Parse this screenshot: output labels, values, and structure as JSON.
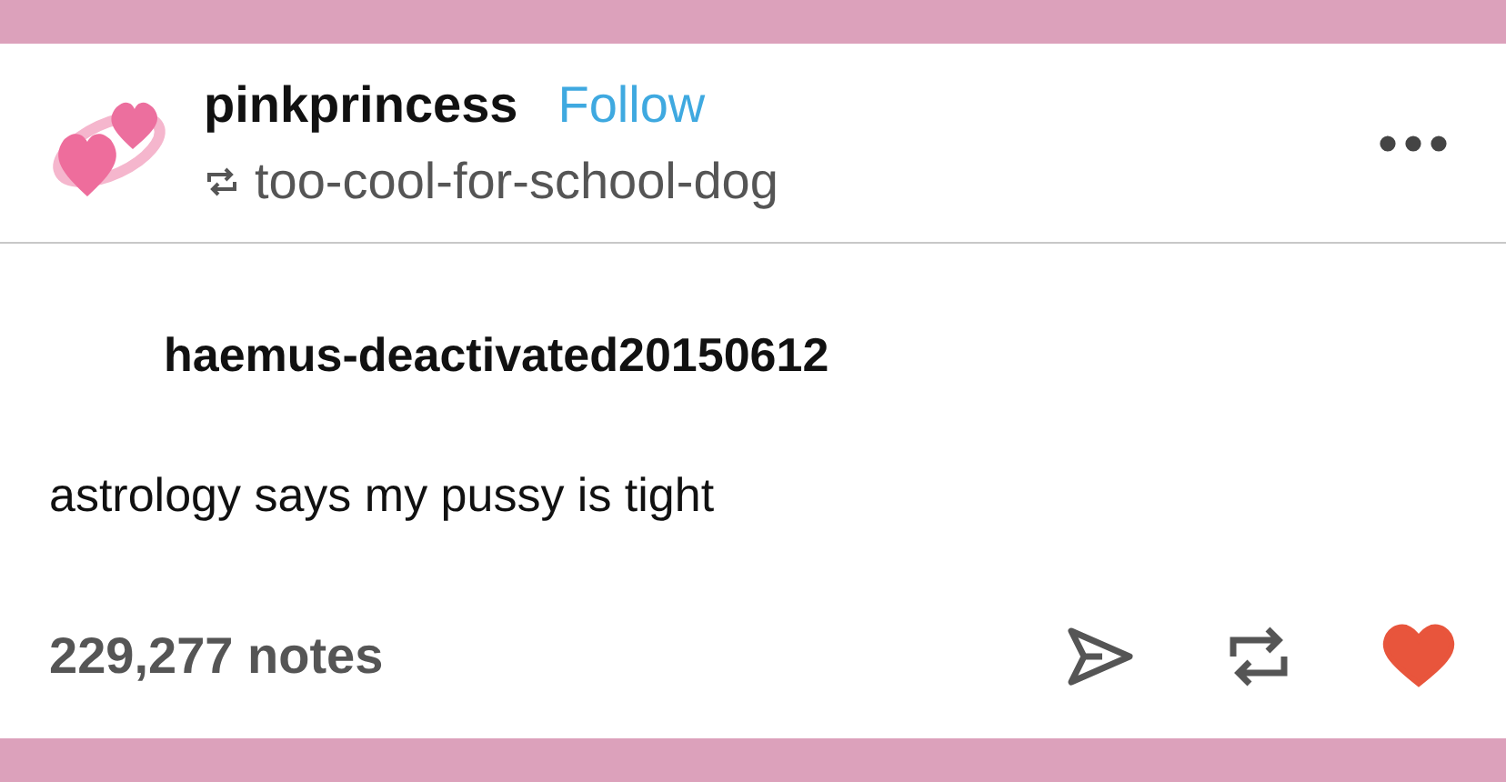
{
  "post": {
    "blog_name": "pinkprincess",
    "follow_label": "Follow",
    "reblogged_from": "too-cool-for-school-dog"
  },
  "reblog": {
    "username": "haemus-deactivated20150612",
    "text": "astrology says my pussy is tight"
  },
  "footer": {
    "notes": "229,277 notes",
    "liked": true
  }
}
